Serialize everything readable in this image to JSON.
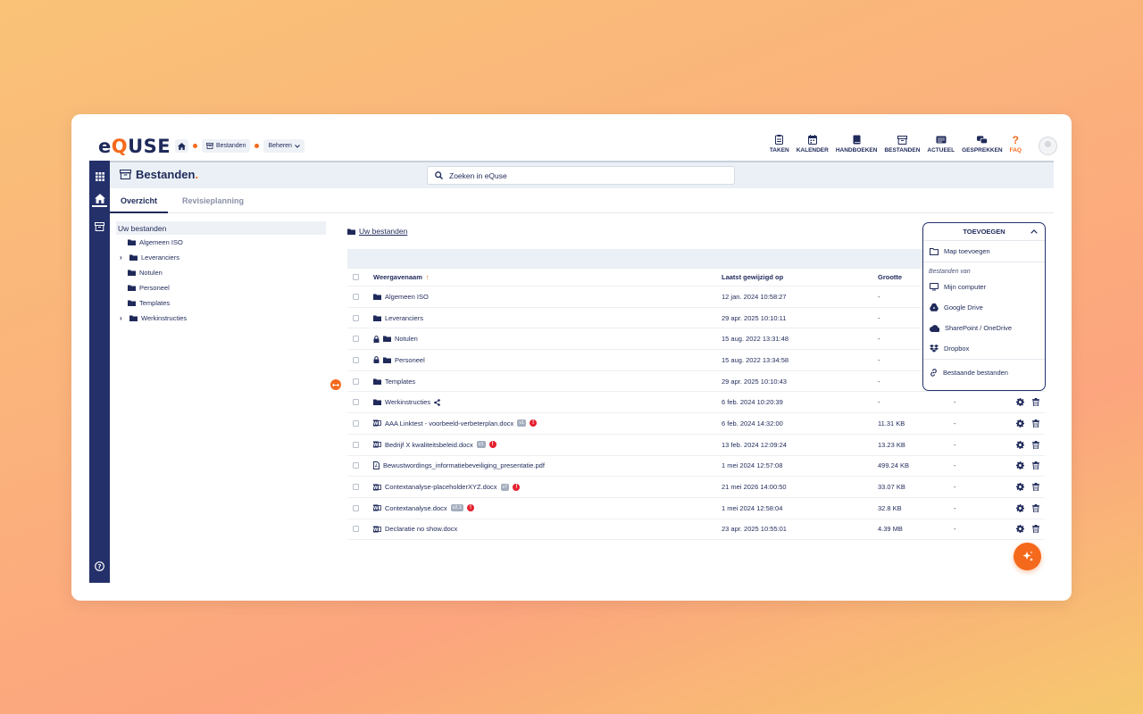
{
  "app": {
    "logo_prefix": "e",
    "logo_q": "Q",
    "logo_suffix": "USE"
  },
  "breadcrumb": {
    "item1": "Bestanden",
    "item2": "Beheren"
  },
  "topnav": [
    {
      "label": "TAKEN",
      "icon": "tasks-icon"
    },
    {
      "label": "KALENDER",
      "icon": "calendar-icon"
    },
    {
      "label": "HANDBOEKEN",
      "icon": "book-icon"
    },
    {
      "label": "BESTANDEN",
      "icon": "archive-icon"
    },
    {
      "label": "ACTUEEL",
      "icon": "news-icon"
    },
    {
      "label": "GESPREKKEN",
      "icon": "chat-icon"
    },
    {
      "label": "FAQ",
      "icon": "question-icon"
    }
  ],
  "header": {
    "title": "Bestanden",
    "title_suffix": ".",
    "search_placeholder": "Zoeken in eQuse"
  },
  "tabs": [
    {
      "label": "Overzicht",
      "active": true
    },
    {
      "label": "Revisieplanning",
      "active": false
    }
  ],
  "tree": {
    "root": "Uw bestanden",
    "items": [
      {
        "label": "Algemeen ISO",
        "expandable": false
      },
      {
        "label": "Leveranciers",
        "expandable": true
      },
      {
        "label": "Notulen",
        "expandable": false
      },
      {
        "label": "Personeel",
        "expandable": false
      },
      {
        "label": "Templates",
        "expandable": false
      },
      {
        "label": "Werkinstructies",
        "expandable": true
      }
    ]
  },
  "path": {
    "current": "Uw bestanden"
  },
  "table": {
    "columns": {
      "name": "Weergavenaam",
      "sort_mark": "↑",
      "date": "Laatst gewijzigd op",
      "size": "Grootte"
    },
    "rows": [
      {
        "type": "folder",
        "name": "Algemeen ISO",
        "date": "12 jan. 2024 10:58:27",
        "size": "-",
        "extra": "",
        "locked": false
      },
      {
        "type": "folder",
        "name": "Leveranciers",
        "date": "29 apr. 2025 10:10:11",
        "size": "-",
        "extra": "",
        "locked": false
      },
      {
        "type": "folder",
        "name": "Notulen",
        "date": "15 aug. 2022 13:31:48",
        "size": "-",
        "extra": "",
        "locked": true
      },
      {
        "type": "folder",
        "name": "Personeel",
        "date": "15 aug. 2022 13:34:58",
        "size": "-",
        "extra": "",
        "locked": true
      },
      {
        "type": "folder",
        "name": "Templates",
        "date": "29 apr. 2025 10:10:43",
        "size": "-",
        "extra": "",
        "locked": false
      },
      {
        "type": "folder",
        "name": "Werkinstructies",
        "date": "6 feb. 2024 10:20:39",
        "size": "-",
        "extra": "-",
        "locked": false,
        "shared": true,
        "actions": true
      },
      {
        "type": "word",
        "name": "AAA Linktest - voorbeeld-verbeterplan.docx",
        "badge": "v1",
        "warn": true,
        "date": "6 feb. 2024 14:32:00",
        "size": "11.31 KB",
        "extra": "-",
        "actions": true
      },
      {
        "type": "word",
        "name": "Bedrijf X kwaliteitsbeleid.docx",
        "badge": "v1",
        "warn": true,
        "date": "13 feb. 2024 12:09:24",
        "size": "13.23 KB",
        "extra": "-",
        "actions": true
      },
      {
        "type": "pdf",
        "name": "Bewustwordings_informatiebeveiliging_presentatie.pdf",
        "date": "1 mei 2024 12:57:08",
        "size": "499.24 KB",
        "extra": "-",
        "actions": true
      },
      {
        "type": "word",
        "name": "Contextanalyse-placeholderXYZ.docx",
        "badge": "v7",
        "warn": true,
        "date": "21 mei 2026 14:00:50",
        "size": "33.07 KB",
        "extra": "-",
        "actions": true
      },
      {
        "type": "word",
        "name": "Contextanalyse.docx",
        "badge": "v2.1",
        "warn": true,
        "date": "1 mei 2024 12:58:04",
        "size": "32.8 KB",
        "extra": "-",
        "actions": true
      },
      {
        "type": "word",
        "name": "Declaratie no show.docx",
        "date": "23 apr. 2025 10:55:01",
        "size": "4.39 MB",
        "extra": "-",
        "actions": true
      }
    ]
  },
  "dropdown": {
    "title": "TOEVOEGEN",
    "add_folder": "Map toevoegen",
    "section_label": "Bestanden van",
    "sources": [
      "Mijn computer",
      "Google Drive",
      "SharePoint / OneDrive",
      "Dropbox"
    ],
    "existing": "Bestaande bestanden"
  },
  "colors": {
    "brand_navy": "#1f2a5a",
    "accent_orange": "#f5691c",
    "rail": "#24306a",
    "warning_red": "#e5202e"
  }
}
